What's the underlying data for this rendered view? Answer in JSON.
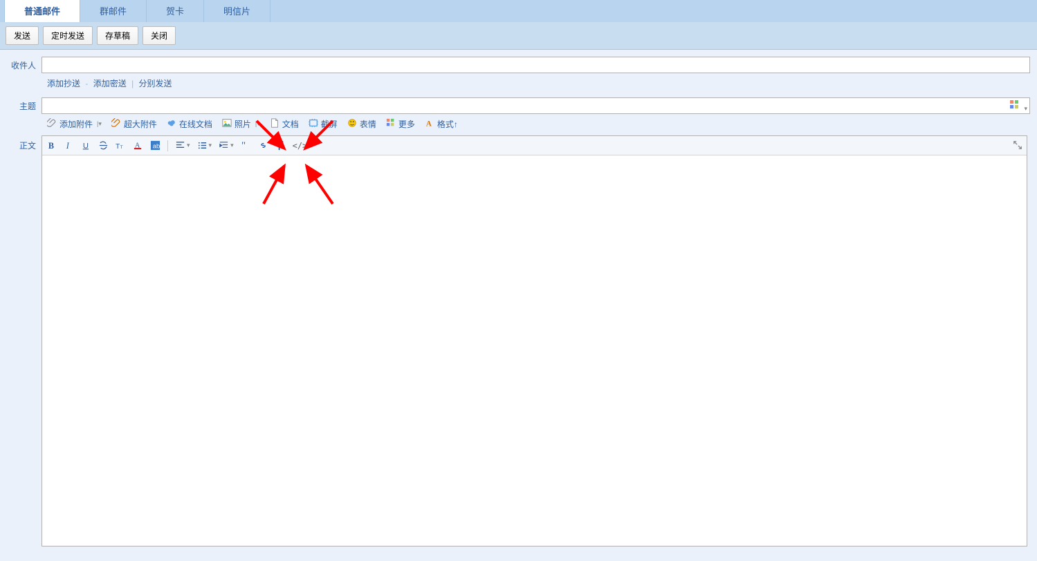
{
  "tabs": [
    {
      "label": "普通邮件",
      "active": true
    },
    {
      "label": "群邮件",
      "active": false
    },
    {
      "label": "贺卡",
      "active": false
    },
    {
      "label": "明信片",
      "active": false
    }
  ],
  "actions": {
    "send": "发送",
    "timed_send": "定时发送",
    "save_draft": "存草稿",
    "close": "关闭"
  },
  "fields": {
    "recipient_label": "收件人",
    "recipient_value": "",
    "subject_label": "主题",
    "subject_value": "",
    "body_label": "正文"
  },
  "links": {
    "add_cc": "添加抄送",
    "add_bcc": "添加密送",
    "send_separately": "分别发送"
  },
  "attach_bar": {
    "add_attachment": "添加附件",
    "big_attachment": "超大附件",
    "online_doc": "在线文档",
    "photo": "照片",
    "document": "文档",
    "screenshot": "截屏",
    "emoji": "表情",
    "more": "更多",
    "format": "格式↑"
  },
  "editor_toolbar": {
    "code_label": "</>"
  }
}
